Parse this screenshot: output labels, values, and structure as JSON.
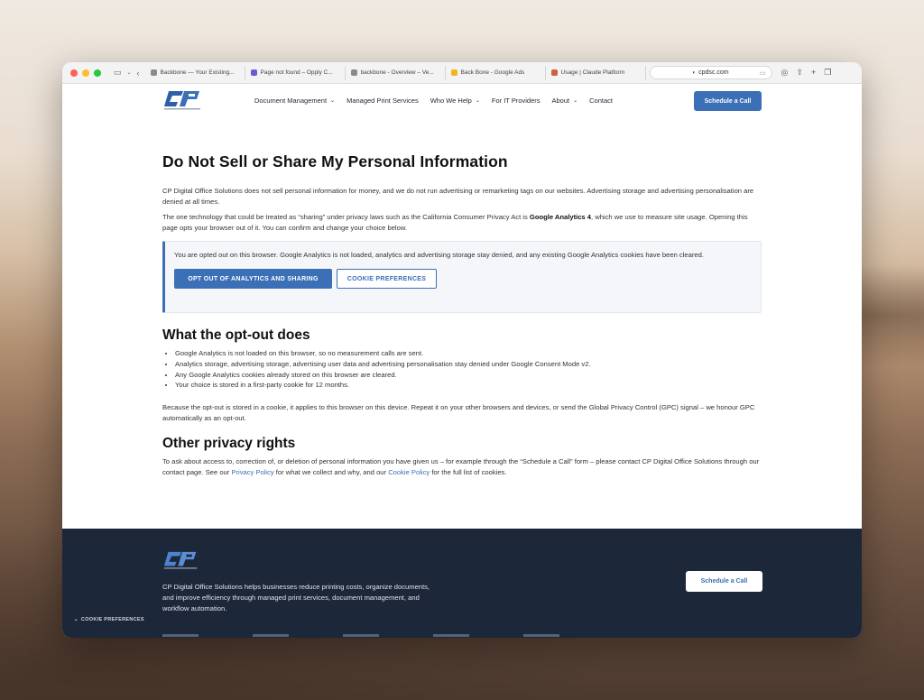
{
  "browser": {
    "tabs": [
      {
        "title": "Backbone — Your Existing...",
        "color": "#8a8a8a"
      },
      {
        "title": "Page not found – Opply C...",
        "color": "#6b5bd6"
      },
      {
        "title": "backbone - Overview – Ve...",
        "color": "#8a8a8a"
      },
      {
        "title": "Back Bone - Google Ads",
        "color": "#f2b51c"
      },
      {
        "title": "Usage | Claude Platform",
        "color": "#c96442"
      }
    ],
    "address": "cpdsc.com"
  },
  "nav": {
    "items": [
      {
        "label": "Document Management",
        "dropdown": true
      },
      {
        "label": "Managed Print Services",
        "dropdown": false
      },
      {
        "label": "Who We Help",
        "dropdown": true
      },
      {
        "label": "For IT Providers",
        "dropdown": false
      },
      {
        "label": "About",
        "dropdown": true
      },
      {
        "label": "Contact",
        "dropdown": false
      }
    ],
    "cta": "Schedule a Call"
  },
  "page": {
    "title": "Do Not Sell or Share My Personal Information",
    "intro1": "CP Digital Office Solutions does not sell personal information for money, and we do not run advertising or remarketing tags on our websites. Advertising storage and advertising personalisation are denied at all times.",
    "intro2_a": "The one technology that could be treated as “sharing” under privacy laws such as the California Consumer Privacy Act is ",
    "intro2_b": "Google Analytics 4",
    "intro2_c": ", which we use to measure site usage. Opening this page opts your browser out of it. You can confirm and change your choice below.",
    "notice": "You are opted out on this browser. Google Analytics is not loaded, analytics and advertising storage stay denied, and any existing Google Analytics cookies have been cleared.",
    "btn_optout": "OPT OUT OF ANALYTICS AND SHARING",
    "btn_prefs": "COOKIE PREFERENCES",
    "h2_optout": "What the opt-out does",
    "bullets": [
      "Google Analytics is not loaded on this browser, so no measurement calls are sent.",
      "Analytics storage, advertising storage, advertising user data and advertising personalisation stay denied under Google Consent Mode v2.",
      "Any Google Analytics cookies already stored on this browser are cleared.",
      "Your choice is stored in a first-party cookie for 12 months."
    ],
    "cookie_note": "Because the opt-out is stored in a cookie, it applies to this browser on this device. Repeat it on your other browsers and devices, or send the Global Privacy Control (GPC) signal – we honour GPC automatically as an opt-out.",
    "h2_rights": "Other privacy rights",
    "rights_a": "To ask about access to, correction of, or deletion of personal information you have given us – for example through the “Schedule a Call” form – please contact CP Digital Office Solutions through our contact page. See our ",
    "rights_link1": "Privacy Policy",
    "rights_b": " for what we collect and why, and our ",
    "rights_link2": "Cookie Policy",
    "rights_c": " for the full list of cookies."
  },
  "footer": {
    "text": "CP Digital Office Solutions helps businesses reduce printing costs, organize documents, and improve efficiency through managed print services, document management, and workflow automation.",
    "cta": "Schedule a Call",
    "cookie_prefs": "COOKIE PREFERENCES"
  },
  "colors": {
    "accent": "#3b6fb6",
    "footer_bg": "#1c2739"
  }
}
